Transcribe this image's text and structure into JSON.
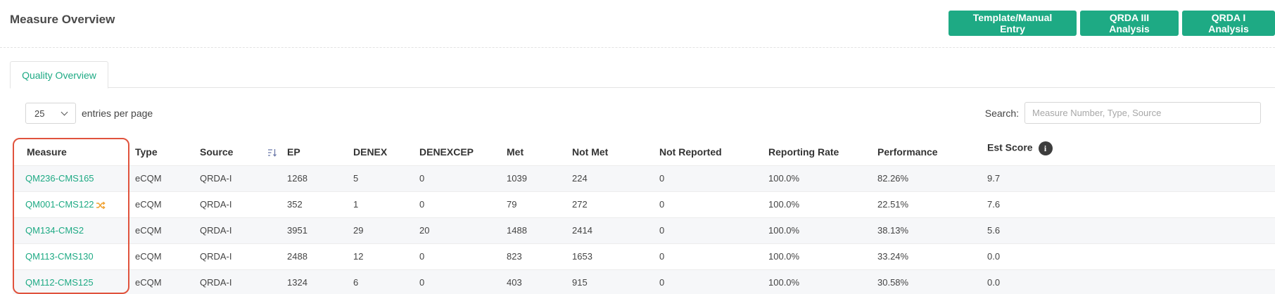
{
  "header": {
    "title": "Measure Overview",
    "buttons": {
      "template": "Template/Manual Entry",
      "qrda3": "QRDA III Analysis",
      "qrda1": "QRDA I Analysis"
    }
  },
  "tabs": {
    "active": "Quality Overview"
  },
  "controls": {
    "entries_value": "25",
    "entries_label": "entries per page",
    "search_label": "Search:",
    "search_placeholder": "Measure Number, Type, Source",
    "search_value": ""
  },
  "table": {
    "columns": [
      "Measure",
      "Type",
      "Source",
      "EP",
      "DENEX",
      "DENEXCEP",
      "Met",
      "Not Met",
      "Not Reported",
      "Reporting Rate",
      "Performance",
      "Est Score"
    ],
    "info_glyph": "i",
    "rows": [
      {
        "measure": "QM236-CMS165",
        "type": "eCQM",
        "source": "QRDA-I",
        "ep": "1268",
        "denex": "5",
        "denexcep": "0",
        "met": "1039",
        "not_met": "224",
        "not_reported": "0",
        "reporting_rate": "100.0%",
        "performance": "82.26%",
        "est_score": "9.7"
      },
      {
        "measure": "QM001-CMS122",
        "type": "eCQM",
        "source": "QRDA-I",
        "ep": "352",
        "denex": "1",
        "denexcep": "0",
        "met": "79",
        "not_met": "272",
        "not_reported": "0",
        "reporting_rate": "100.0%",
        "performance": "22.51%",
        "est_score": "7.6",
        "inverse_icon": "shuffle-icon"
      },
      {
        "measure": "QM134-CMS2",
        "type": "eCQM",
        "source": "QRDA-I",
        "ep": "3951",
        "denex": "29",
        "denexcep": "20",
        "met": "1488",
        "not_met": "2414",
        "not_reported": "0",
        "reporting_rate": "100.0%",
        "performance": "38.13%",
        "est_score": "5.6"
      },
      {
        "measure": "QM113-CMS130",
        "type": "eCQM",
        "source": "QRDA-I",
        "ep": "2488",
        "denex": "12",
        "denexcep": "0",
        "met": "823",
        "not_met": "1653",
        "not_reported": "0",
        "reporting_rate": "100.0%",
        "performance": "33.24%",
        "est_score": "0.0"
      },
      {
        "measure": "QM112-CMS125",
        "type": "eCQM",
        "source": "QRDA-I",
        "ep": "1324",
        "denex": "6",
        "denexcep": "0",
        "met": "403",
        "not_met": "915",
        "not_reported": "0",
        "reporting_rate": "100.0%",
        "performance": "30.58%",
        "est_score": "0.0"
      }
    ]
  },
  "colors": {
    "accent": "#1eaa84",
    "highlight": "#e0533d",
    "shuffle_icon": "#f0a233"
  }
}
